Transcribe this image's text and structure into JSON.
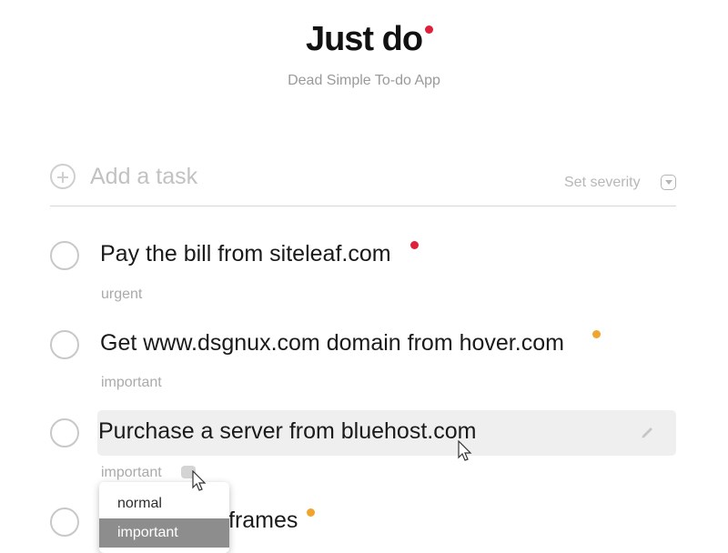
{
  "header": {
    "title": "Just do",
    "title_dot_color": "#e0203b",
    "subtitle": "Dead Simple To-do App"
  },
  "add_task": {
    "label": "Add a task",
    "icon": "plus-circle-icon",
    "severity_label": "Set severity",
    "severity_icon": "chevron-down-icon"
  },
  "tasks": [
    {
      "text": "Pay the bill from siteleaf.com",
      "severity": "urgent",
      "dot_color": "#e0203b"
    },
    {
      "text": "Get www.dsgnux.com domain from hover.com",
      "severity": "important",
      "dot_color": "#f0a52c"
    },
    {
      "text": "Purchase a server from bluehost.com",
      "severity": "important",
      "editing": true,
      "edit_icon": "pencil-icon"
    },
    {
      "text": "frames",
      "dot_color": "#f0a52c"
    }
  ],
  "severity_dropdown": {
    "options": [
      "normal",
      "important"
    ],
    "selected": "important"
  }
}
